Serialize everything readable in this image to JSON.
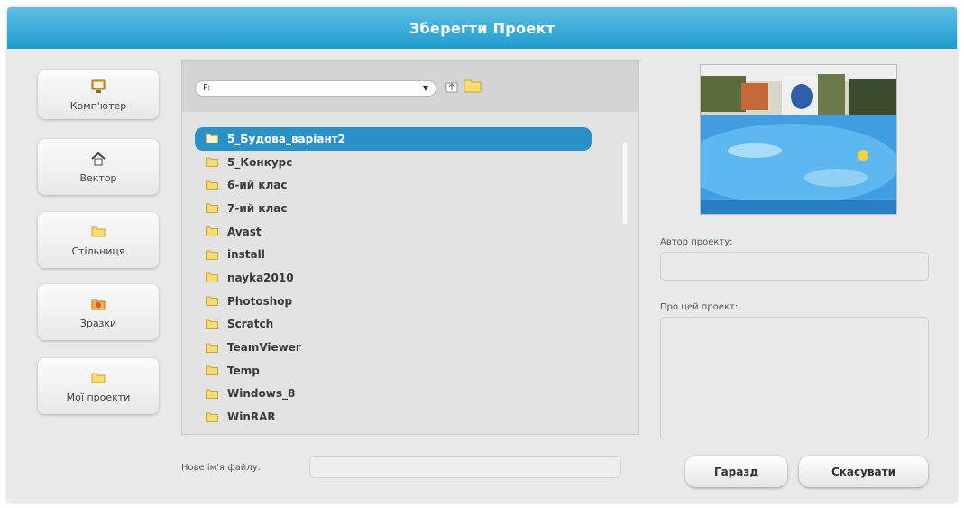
{
  "dialog": {
    "title": "Зберегти Проект"
  },
  "sidebar": {
    "items": [
      {
        "label": "Комп'ютер",
        "icon": "computer-icon"
      },
      {
        "label": "Вектор",
        "icon": "home-icon"
      },
      {
        "label": "Стільниця",
        "icon": "folder-icon"
      },
      {
        "label": "Зразки",
        "icon": "samples-icon"
      },
      {
        "label": "Мої проекти",
        "icon": "folder-icon"
      }
    ]
  },
  "browser": {
    "drive": "F:",
    "files": [
      "5_Будова_варіант2",
      "5_Конкурс",
      "6-ий клас",
      "7-ий клас",
      "Avast",
      "install",
      "nayka2010",
      "Photoshop",
      "Scratch",
      "TeamViewer",
      "Temp",
      "Windows_8",
      "WinRAR"
    ],
    "selected_index": 0
  },
  "filename": {
    "label": "Нове ім'я файлу:",
    "value": ""
  },
  "project": {
    "author_label": "Автор проекту:",
    "author_value": "",
    "about_label": "Про цей проект:",
    "about_value": ""
  },
  "buttons": {
    "ok": "Гаразд",
    "cancel": "Скасувати"
  },
  "colors": {
    "title_bar": "#1f9ccd",
    "selection": "#2a91c8",
    "folder": "#f7dc6f"
  }
}
